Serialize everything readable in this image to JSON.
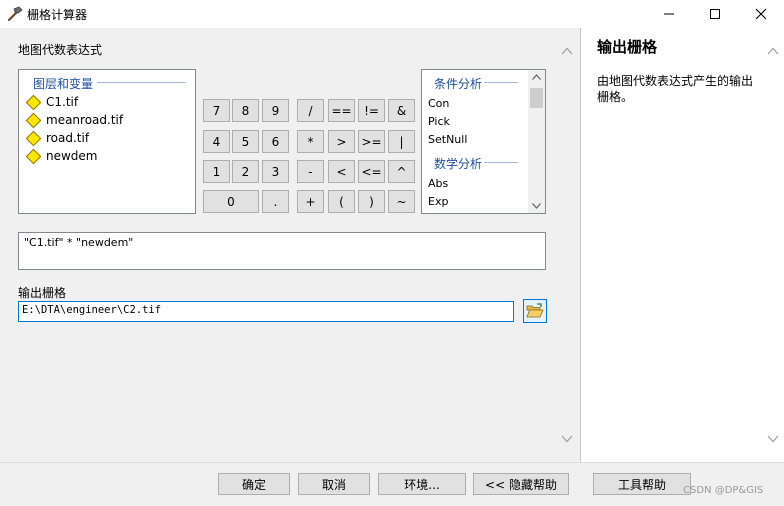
{
  "window": {
    "title": "栅格计算器",
    "minimize_icon": "minimize-icon",
    "maximize_icon": "maximize-icon",
    "close_icon": "close-icon"
  },
  "expression_label": "地图代数表达式",
  "layers": {
    "group_title": "图层和变量",
    "items": [
      "C1.tif",
      "meanroad.tif",
      "road.tif",
      "newdem"
    ]
  },
  "calculator": {
    "digits": [
      "7",
      "8",
      "9",
      "4",
      "5",
      "6",
      "1",
      "2",
      "3",
      "0",
      "."
    ],
    "operators": [
      "/",
      "==",
      "!=",
      "&",
      "*",
      ">",
      ">=",
      "|",
      "-",
      "<",
      "<=",
      "^",
      "+",
      "(",
      ")",
      "~"
    ]
  },
  "functions": {
    "group1_title": "条件分析",
    "group1_items": [
      "Con",
      "Pick",
      "SetNull"
    ],
    "group2_title": "数学分析",
    "group2_items": [
      "Abs",
      "Exp"
    ]
  },
  "expression_value": "\"C1.tif\" * \"newdem\"",
  "output": {
    "label": "输出栅格",
    "value": "E:\\DTA\\engineer\\C2.tif",
    "browse_icon": "folder-open-icon"
  },
  "help": {
    "title": "输出栅格",
    "body": "由地图代数表达式产生的输出栅格。"
  },
  "buttons": {
    "ok": "确定",
    "cancel": "取消",
    "environments": "环境...",
    "hide_help": "<< 隐藏帮助",
    "tool_help": "工具帮助"
  },
  "watermark": "CSDN @DP&GIS",
  "colors": {
    "accent": "#0078d7",
    "group_title": "#1f4e9c",
    "diamond": "#ffe600"
  }
}
